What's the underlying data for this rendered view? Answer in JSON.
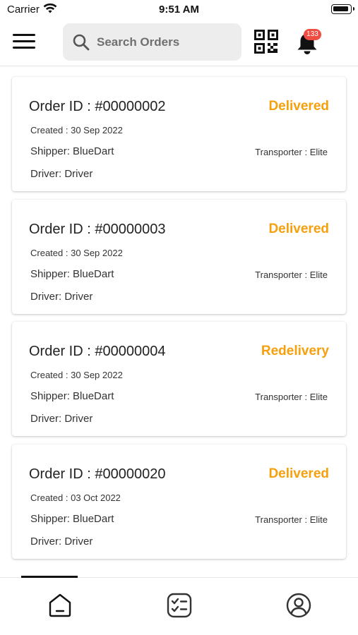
{
  "status_bar": {
    "carrier": "Carrier",
    "time": "9:51 AM"
  },
  "header": {
    "search_placeholder": "Search Orders",
    "notification_count": "133"
  },
  "orders": [
    {
      "id_label": "Order ID : #00000002",
      "status": "Delivered",
      "created": "Created : 30 Sep 2022",
      "shipper": "Shipper: BlueDart",
      "transporter": "Transporter : Elite",
      "driver": "Driver: Driver"
    },
    {
      "id_label": "Order ID : #00000003",
      "status": "Delivered",
      "created": "Created : 30 Sep 2022",
      "shipper": "Shipper: BlueDart",
      "transporter": "Transporter : Elite",
      "driver": "Driver: Driver"
    },
    {
      "id_label": "Order ID : #00000004",
      "status": "Redelivery",
      "created": "Created : 30 Sep 2022",
      "shipper": "Shipper: BlueDart",
      "transporter": "Transporter : Elite",
      "driver": "Driver: Driver"
    },
    {
      "id_label": "Order ID : #00000020",
      "status": "Delivered",
      "created": "Created : 03 Oct 2022",
      "shipper": "Shipper: BlueDart",
      "transporter": "Transporter : Elite",
      "driver": "Driver: Driver"
    }
  ],
  "colors": {
    "status_accent": "#f5a00c",
    "badge": "#ef4d42"
  },
  "bottom_nav": {
    "items": [
      "home-icon",
      "checklist-icon",
      "user-profile-icon"
    ],
    "active": "home-icon"
  }
}
